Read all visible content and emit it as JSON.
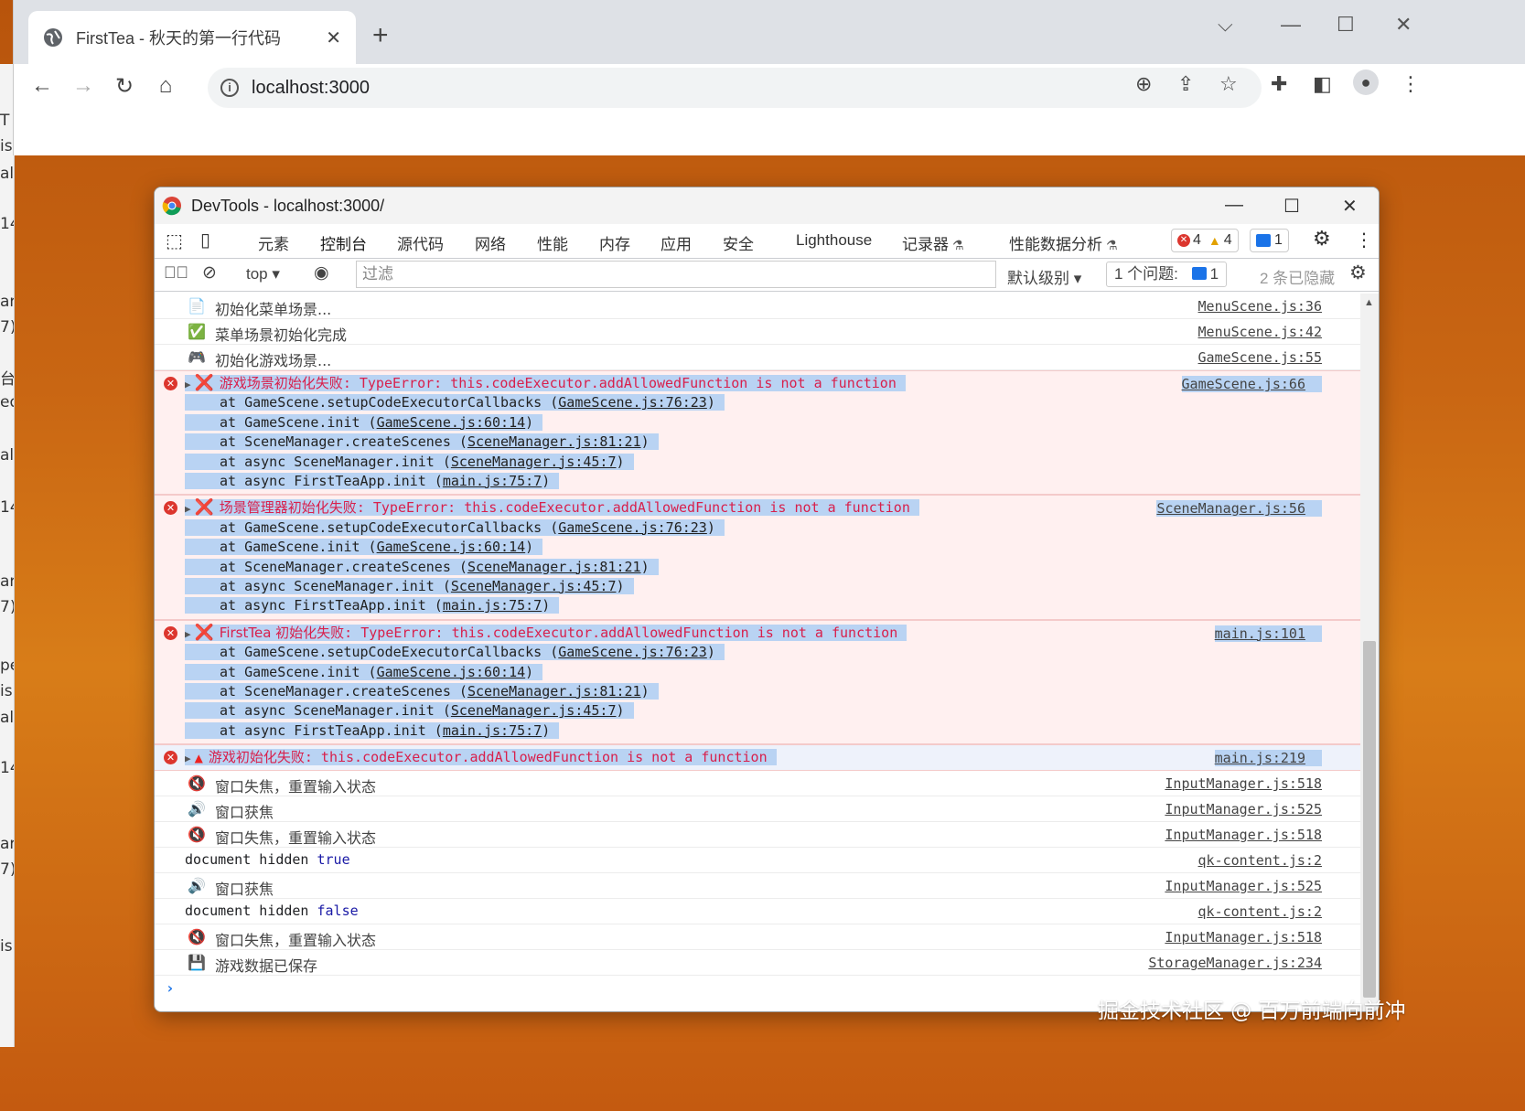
{
  "background_app": {
    "fragments": [
      "T",
      "is",
      "all",
      "14",
      "ar",
      "7)",
      "台",
      "ed",
      "all",
      "14",
      "ar",
      "7)",
      "pe",
      "is",
      "all",
      "14",
      "ar",
      "7)",
      "is"
    ]
  },
  "browser": {
    "tab_title": "FirstTea - 秋天的第一行代码",
    "tab_close": "✕",
    "new_tab": "+",
    "url": "localhost:3000",
    "window_controls": [
      "⌵",
      "—",
      "☐",
      "✕"
    ]
  },
  "devtools": {
    "title": "DevTools - localhost:3000/",
    "window_controls": [
      "—",
      "☐",
      "✕"
    ],
    "tabs": [
      "元素",
      "控制台",
      "源代码",
      "网络",
      "性能",
      "内存",
      "应用",
      "安全",
      "Lighthouse",
      "记录器",
      "性能数据分析"
    ],
    "active_tab": "控制台",
    "errors_count": "4",
    "warnings_count": "4",
    "issues_count": "1",
    "filterbar": {
      "context": "top",
      "filter_placeholder": "过滤",
      "level": "默认级别",
      "issues_label": "1 个问题:",
      "issues_count": "1",
      "hidden": "2 条已隐藏"
    }
  },
  "console": {
    "top_rows": [
      {
        "icon": "📄",
        "text": "初始化菜单场景...",
        "source": "MenuScene.js:36"
      },
      {
        "icon": "✅",
        "text": "菜单场景初始化完成",
        "source": "MenuScene.js:42"
      },
      {
        "icon": "🎮",
        "text": "初始化游戏场景...",
        "source": "GameScene.js:55"
      }
    ],
    "errors": [
      {
        "prefix": "游戏场景初始化失败",
        "message": ": TypeError: this.codeExecutor.addAllowedFunction is not a function",
        "source": "GameScene.js:66",
        "stack": [
          {
            "text": "at GameScene.setupCodeExecutorCallbacks (",
            "link": "GameScene.js:76:23"
          },
          {
            "text": "at GameScene.init (",
            "link": "GameScene.js:60:14"
          },
          {
            "text": "at SceneManager.createScenes (",
            "link": "SceneManager.js:81:21"
          },
          {
            "text": "at async SceneManager.init (",
            "link": "SceneManager.js:45:7"
          },
          {
            "text": "at async FirstTeaApp.init (",
            "link": "main.js:75:7"
          }
        ]
      },
      {
        "prefix": "场景管理器初始化失败",
        "message": ": TypeError: this.codeExecutor.addAllowedFunction is not a function",
        "source": "SceneManager.js:56",
        "stack": [
          {
            "text": "at GameScene.setupCodeExecutorCallbacks (",
            "link": "GameScene.js:76:23"
          },
          {
            "text": "at GameScene.init (",
            "link": "GameScene.js:60:14"
          },
          {
            "text": "at SceneManager.createScenes (",
            "link": "SceneManager.js:81:21"
          },
          {
            "text": "at async SceneManager.init (",
            "link": "SceneManager.js:45:7"
          },
          {
            "text": "at async FirstTeaApp.init (",
            "link": "main.js:75:7"
          }
        ]
      },
      {
        "prefix": "FirstTea 初始化失败",
        "message": ": TypeError: this.codeExecutor.addAllowedFunction is not a function",
        "source": "main.js:101",
        "stack": [
          {
            "text": "at GameScene.setupCodeExecutorCallbacks (",
            "link": "GameScene.js:76:23"
          },
          {
            "text": "at GameScene.init (",
            "link": "GameScene.js:60:14"
          },
          {
            "text": "at SceneManager.createScenes (",
            "link": "SceneManager.js:81:21"
          },
          {
            "text": "at async SceneManager.init (",
            "link": "SceneManager.js:45:7"
          },
          {
            "text": "at async FirstTeaApp.init (",
            "link": "main.js:75:7"
          }
        ]
      }
    ],
    "last_error": {
      "prefix": "游戏初始化失败",
      "message": ": this.codeExecutor.addAllowedFunction is not a function",
      "source": "main.js:219"
    },
    "bottom_rows": [
      {
        "icon": "🔇",
        "text": "窗口失焦，重置输入状态",
        "source": "InputManager.js:518",
        "mono": false
      },
      {
        "icon": "🔊",
        "text": "窗口获焦",
        "source": "InputManager.js:525",
        "mono": false
      },
      {
        "icon": "🔇",
        "text": "窗口失焦，重置输入状态",
        "source": "InputManager.js:518",
        "mono": false
      },
      {
        "icon": "",
        "text": "document hidden ",
        "value": "true",
        "source": "qk-content.js:2",
        "mono": true
      },
      {
        "icon": "🔊",
        "text": "窗口获焦",
        "source": "InputManager.js:525",
        "mono": false
      },
      {
        "icon": "",
        "text": "document hidden ",
        "value": "false",
        "source": "qk-content.js:2",
        "mono": true
      },
      {
        "icon": "🔇",
        "text": "窗口失焦，重置输入状态",
        "source": "InputManager.js:518",
        "mono": false
      },
      {
        "icon": "💾",
        "text": "游戏数据已保存",
        "source": "StorageManager.js:234",
        "mono": false
      }
    ],
    "prompt": "›"
  },
  "watermark": "掘金技术社区 @ 百万前端向前冲",
  "colors": {
    "error_bg": "#fff0f0",
    "error_text": "#d8204c",
    "selection": "#b9d3f3",
    "accent": "#1a73e8"
  }
}
